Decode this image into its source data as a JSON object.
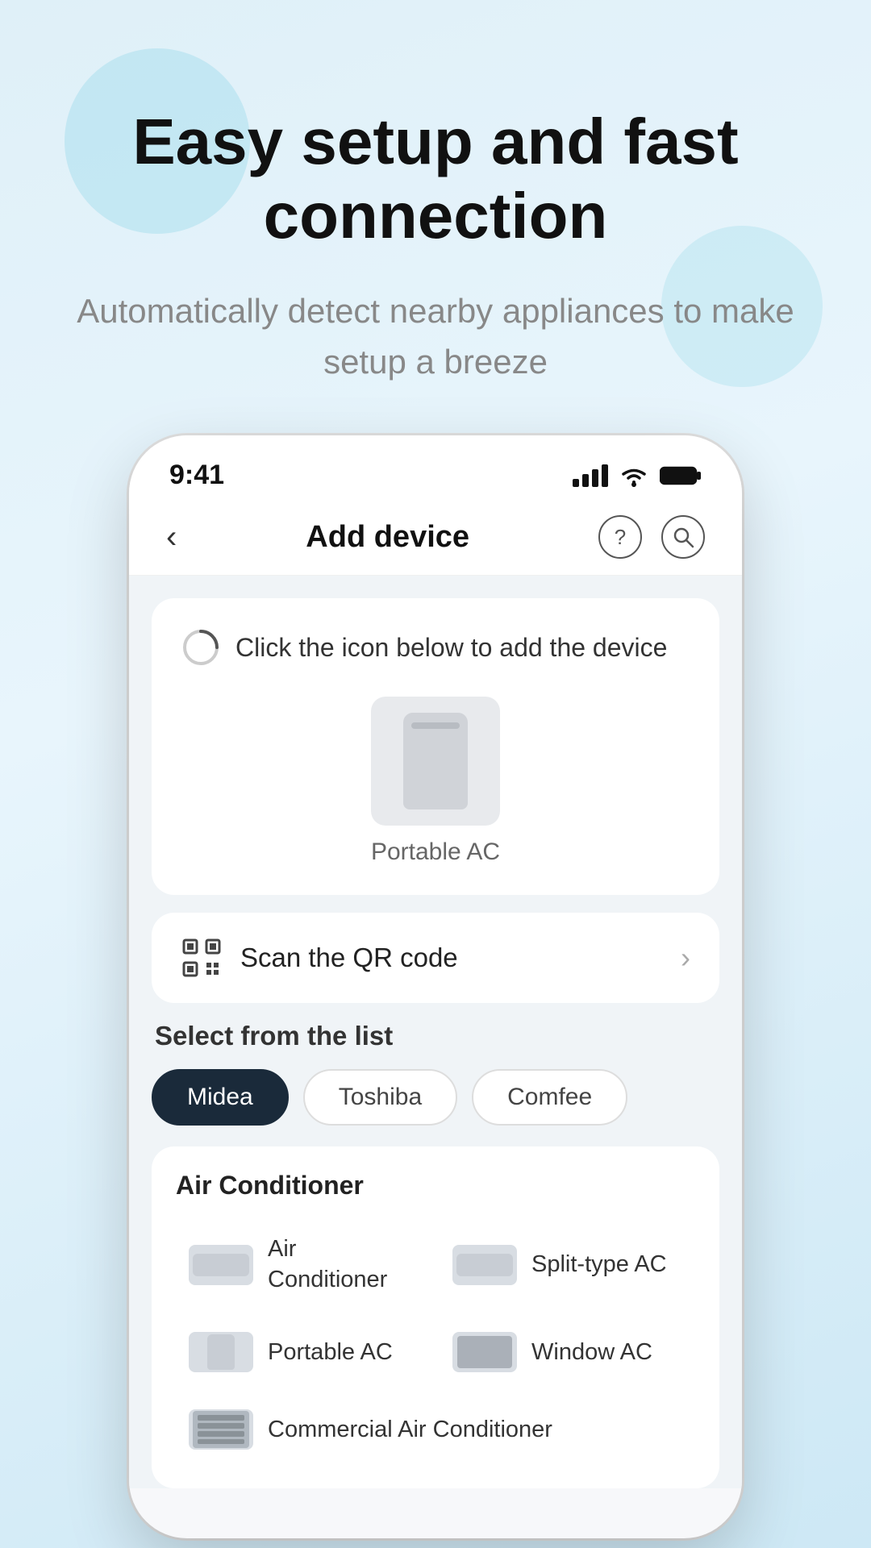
{
  "hero": {
    "title": "Easy setup and fast connection",
    "subtitle": "Automatically detect nearby appliances to make setup a breeze"
  },
  "status_bar": {
    "time": "9:41"
  },
  "nav": {
    "title": "Add device",
    "back_label": "‹"
  },
  "detect_card": {
    "hint": "Click the icon below to add the device",
    "device_label": "Portable AC"
  },
  "qr_section": {
    "label": "Scan the QR code"
  },
  "select_section": {
    "title": "Select from the list",
    "brands": [
      {
        "name": "Midea",
        "active": true
      },
      {
        "name": "Toshiba",
        "active": false
      },
      {
        "name": "Comfee",
        "active": false
      }
    ],
    "category": "Air Conditioner",
    "devices": [
      {
        "name": "Air Conditioner",
        "type": "split"
      },
      {
        "name": "Split-type AC",
        "type": "split"
      },
      {
        "name": "Portable AC",
        "type": "portable"
      },
      {
        "name": "Window AC",
        "type": "window"
      },
      {
        "name": "Commercial Air Conditioner",
        "type": "commercial"
      }
    ]
  }
}
